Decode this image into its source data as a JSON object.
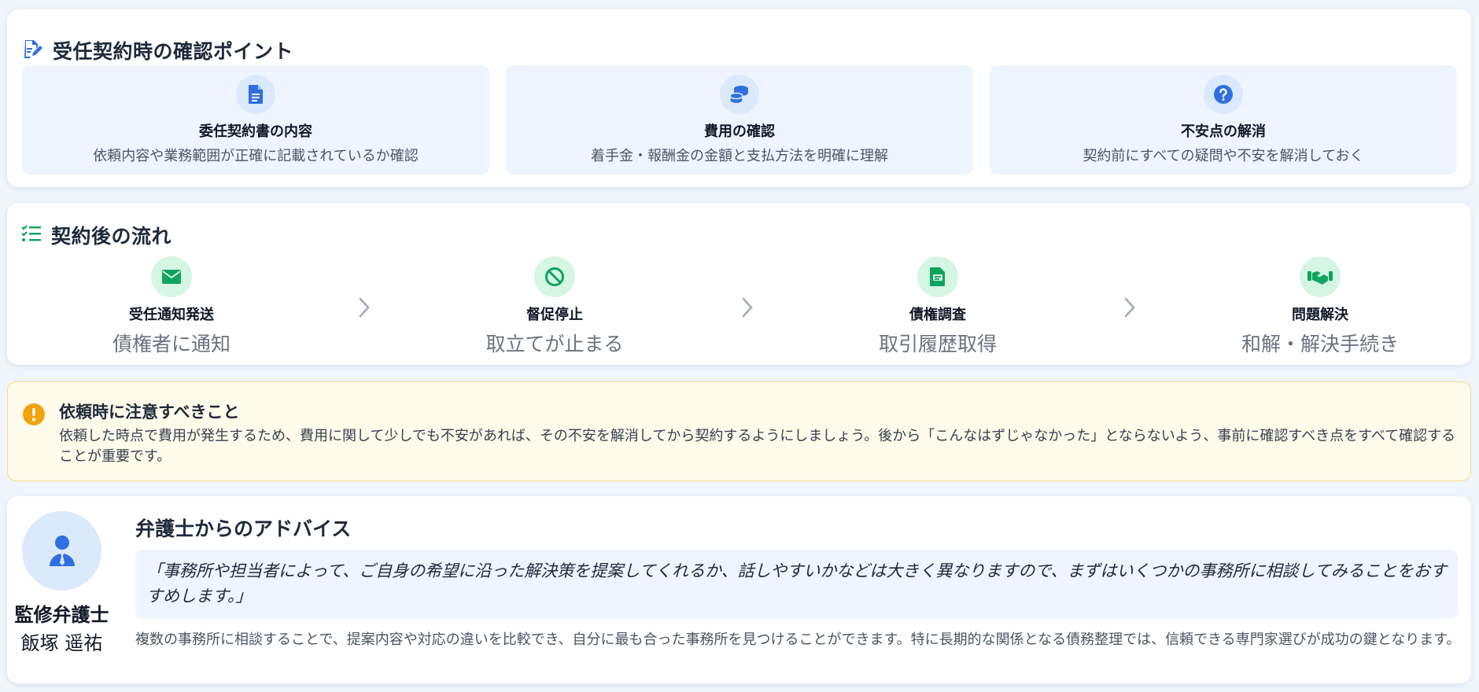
{
  "sections": {
    "points": {
      "title": "受任契約時の確認ポイント",
      "icon": "document-edit-icon",
      "items": [
        {
          "icon": "file-text-icon",
          "title": "委任契約書の内容",
          "desc": "依頼内容や業務範囲が正確に記載されているか確認"
        },
        {
          "icon": "coins-icon",
          "title": "費用の確認",
          "desc": "着手金・報酬金の金額と支払方法を明確に理解"
        },
        {
          "icon": "question-circle-icon",
          "title": "不安点の解消",
          "desc": "契約前にすべての疑問や不安を解消しておく"
        }
      ]
    },
    "flow": {
      "title": "契約後の流れ",
      "icon": "checklist-icon",
      "steps": [
        {
          "icon": "envelope-icon",
          "title": "受任通知発送",
          "desc": "債権者に通知"
        },
        {
          "icon": "ban-icon",
          "title": "督促停止",
          "desc": "取立てが止まる"
        },
        {
          "icon": "file-search-icon",
          "title": "債権調査",
          "desc": "取引履歴取得"
        },
        {
          "icon": "handshake-icon",
          "title": "問題解決",
          "desc": "和解・解決手続き"
        }
      ]
    },
    "notice": {
      "title": "依頼時に注意すべきこと",
      "icon": "exclamation-circle-icon",
      "body": "依頼した時点で費用が発生するため、費用に関して少しでも不安があれば、その不安を解消してから契約するようにしましょう。後から「こんなはずじゃなかった」とならないよう、事前に確認すべき点をすべて確認することが重要です。"
    },
    "advice": {
      "title": "弁護士からのアドバイス",
      "role": "監修弁護士",
      "name": "飯塚 遥祐",
      "avatar_icon": "user-tie-icon",
      "quote": "「事務所や担当者によって、ご自身の希望に沿った解決策を提案してくれるか、話しやすいかなどは大きく異なりますので、まずはいくつかの事務所に相談してみることをおすすめします。」",
      "body": "複数の事務所に相談することで、提案内容や対応の違いを比較でき、自分に最も合った事務所を見つけることができます。特に長期的な関係となる債務整理では、信頼できる専門家選びが成功の鍵となります。"
    }
  },
  "colors": {
    "blue_accent": "#2f6fe0",
    "green_accent": "#11a35e",
    "warning_accent": "#f2a20d",
    "tile_bg": "#eef5fe"
  }
}
